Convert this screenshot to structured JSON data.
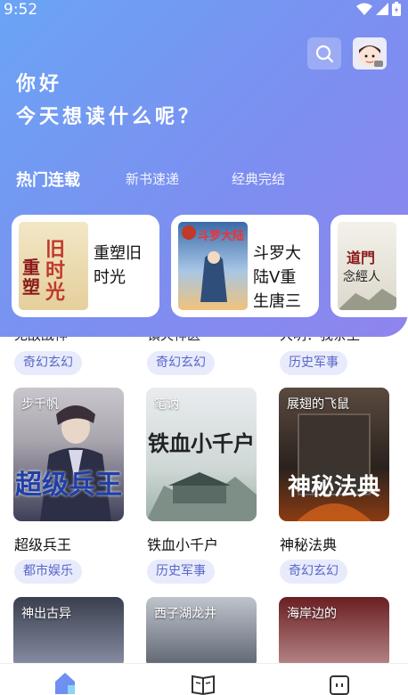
{
  "status_bar": {
    "time": "9:52"
  },
  "header": {
    "greeting_line1": "你好",
    "greeting_line2": "今天想读什么呢？",
    "search_icon": "search-icon",
    "avatar_icon": "avatar"
  },
  "tabs": [
    {
      "label": "热门连载",
      "active": true
    },
    {
      "label": "新书速递",
      "active": false
    },
    {
      "label": "经典完结",
      "active": false
    }
  ],
  "featured": [
    {
      "title": "重塑旧时光",
      "cover_text": "重塑旧时光"
    },
    {
      "title": "斗罗大陆V重生唐三",
      "cover_text": "斗罗大陆"
    },
    {
      "title": "",
      "cover_text": "道門念經人"
    }
  ],
  "peek_row": [
    {
      "title": "无敌战神",
      "tag": "奇幻玄幻"
    },
    {
      "title": "镇天神医",
      "tag": "奇幻玄幻"
    },
    {
      "title": "大明：我亲王",
      "tag": "历史军事"
    }
  ],
  "books": [
    {
      "title": "超级兵王",
      "author": "步千帆",
      "cover_text": "超级兵王",
      "tag": "都市娱乐"
    },
    {
      "title": "铁血小千户",
      "author": "笔讷",
      "cover_text": "铁血小千户",
      "tag": "历史军事"
    },
    {
      "title": "神秘法典",
      "author": "展翅的飞鼠",
      "cover_text": "神秘法典",
      "tag": "奇幻玄幻"
    }
  ],
  "books_bottom": [
    {
      "author": "神出古异"
    },
    {
      "author": "西子湖龙井"
    },
    {
      "author": "海岸边的"
    }
  ],
  "bottom_nav": [
    {
      "name": "home-icon",
      "active": true
    },
    {
      "name": "bookshelf-icon",
      "active": false
    },
    {
      "name": "profile-icon",
      "active": false
    }
  ],
  "colors": {
    "accent": "#7c8ff0",
    "tag_bg": "#e8ebfb",
    "tag_text": "#5a66c9"
  }
}
